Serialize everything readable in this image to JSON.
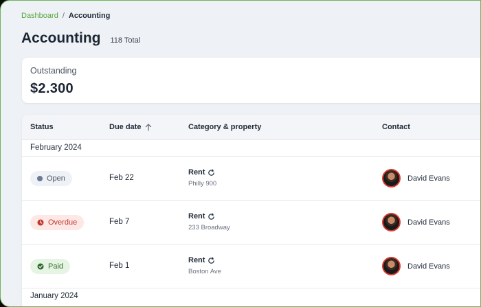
{
  "breadcrumb": {
    "parent": "Dashboard",
    "separator": "/",
    "current": "Accounting"
  },
  "header": {
    "title": "Accounting",
    "total": "118 Total"
  },
  "summary": {
    "label": "Outstanding",
    "value": "$2.300"
  },
  "table": {
    "columns": {
      "status": "Status",
      "due_date": "Due date",
      "category": "Category & property",
      "contact": "Contact"
    },
    "sort_icon": "arrow-up-icon",
    "groups": [
      "February 2024",
      "January 2024"
    ],
    "rows": [
      {
        "status": "Open",
        "due": "Feb 22",
        "category": "Rent",
        "property": "Philly 900",
        "contact": "David Evans"
      },
      {
        "status": "Overdue",
        "due": "Feb 7",
        "category": "Rent",
        "property": "233 Broadway",
        "contact": "David Evans"
      },
      {
        "status": "Paid",
        "due": "Feb 1",
        "category": "Rent",
        "property": "Boston Ave",
        "contact": "David Evans"
      }
    ]
  },
  "colors": {
    "accent": "#5aa63f",
    "overdue": "#c0392b",
    "paid": "#2f6b2a"
  }
}
